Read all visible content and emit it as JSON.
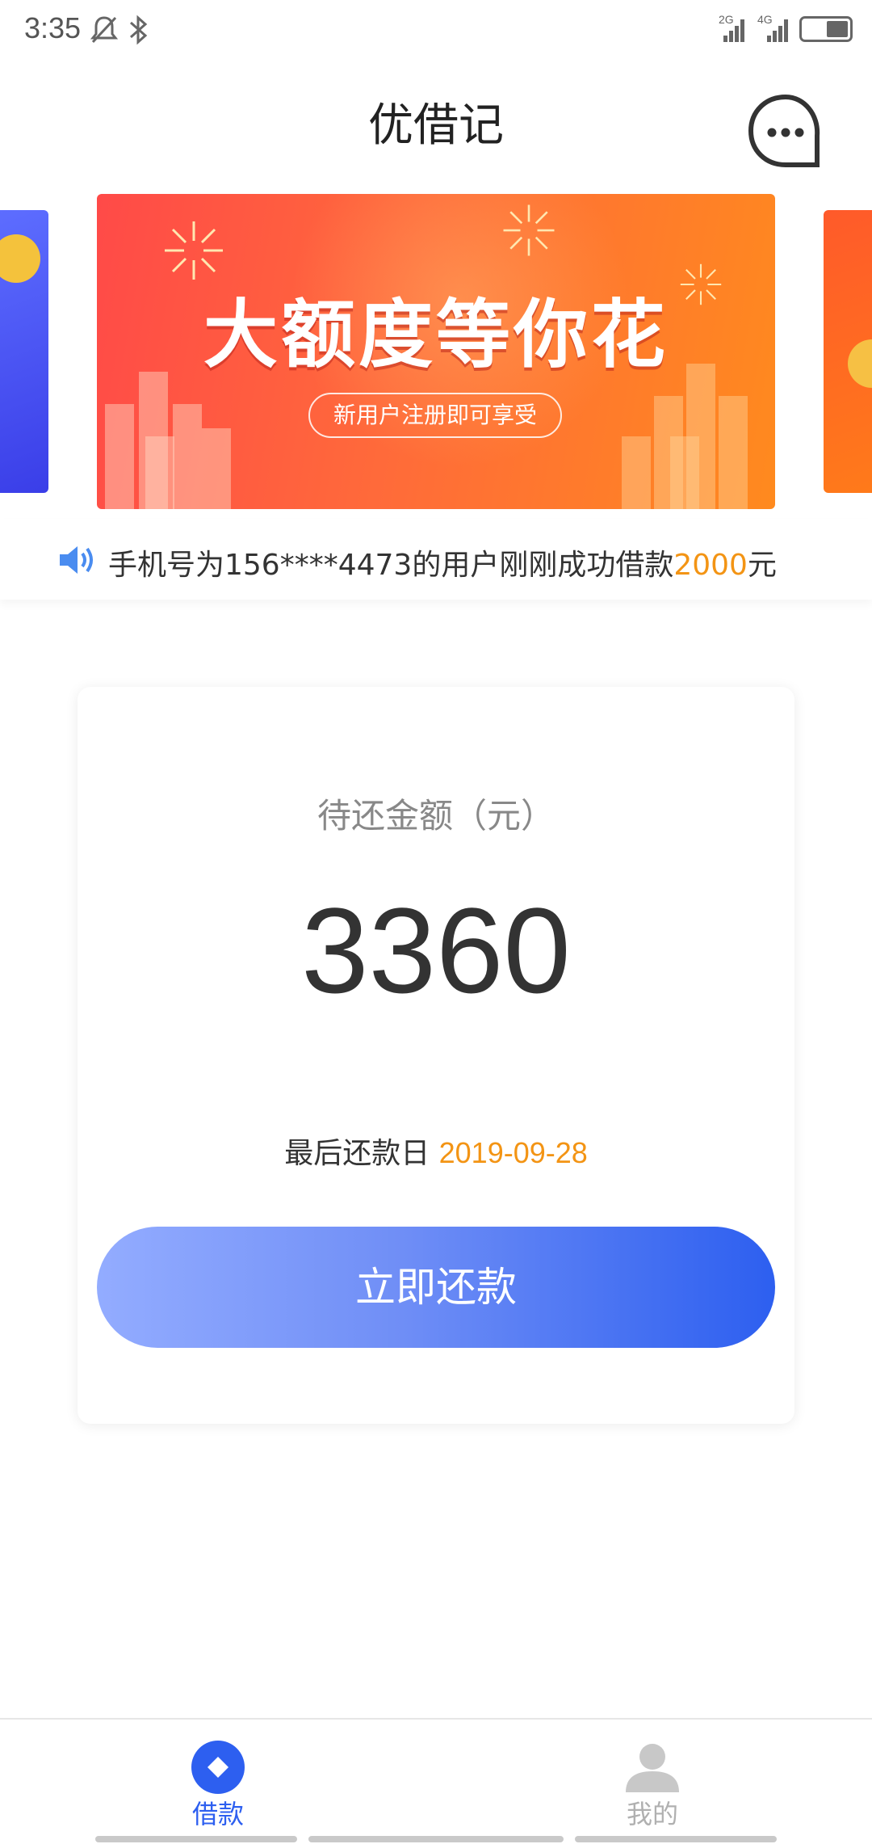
{
  "status_bar": {
    "time": "3:35",
    "net1": "2G",
    "net2": "4G"
  },
  "header": {
    "title": "优借记"
  },
  "banner": {
    "title": "大额度等你花",
    "subtitle": "新用户注册即可享受"
  },
  "notice": {
    "prefix": "手机号为156****4473的用户刚刚成功借款",
    "amount": "2000",
    "suffix": "元"
  },
  "card": {
    "label": "待还金额（元）",
    "amount": "3360",
    "due_label": "最后还款日 ",
    "due_date": "2019-09-28",
    "button_label": "立即还款"
  },
  "tabs": [
    {
      "label": "借款",
      "active": true
    },
    {
      "label": "我的",
      "active": false
    }
  ],
  "colors": {
    "accent_blue": "#2d5ff0",
    "highlight_orange": "#f39414",
    "inactive": "#bfbfbf"
  }
}
